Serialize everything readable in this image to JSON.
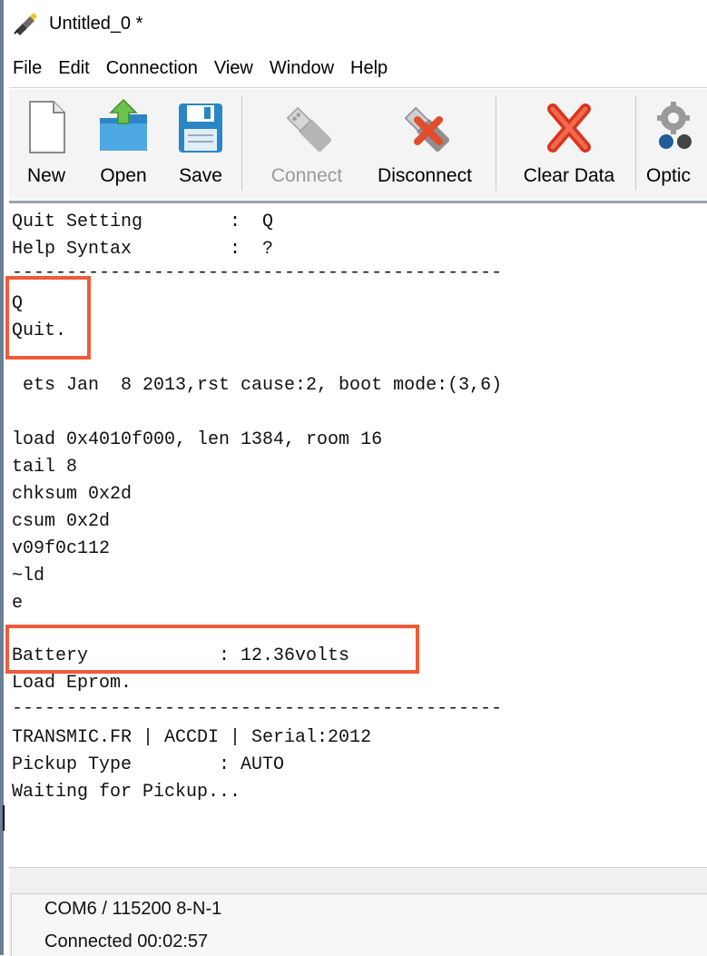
{
  "window": {
    "title": "Untitled_0 *"
  },
  "menu": [
    "File",
    "Edit",
    "Connection",
    "View",
    "Window",
    "Help"
  ],
  "toolbar": {
    "new": "New",
    "open": "Open",
    "save": "Save",
    "connect": "Connect",
    "disconnect": "Disconnect",
    "clear_data": "Clear Data",
    "options": "Optic"
  },
  "terminal": {
    "lines": [
      "Quit Setting        :  Q",
      "Help Syntax         :  ?",
      "---------------------------------------------",
      "Q",
      "Quit.",
      "",
      " ets Jan  8 2013,rst cause:2, boot mode:(3,6)",
      "",
      "load 0x4010f000, len 1384, room 16",
      "tail 8",
      "chksum 0x2d",
      "csum 0x2d",
      "v09f0c112",
      "~ld",
      "e",
      "",
      "Battery            : 12.36volts",
      "Load Eprom.",
      "---------------------------------------------",
      "TRANSMIC.FR | ACCDI | Serial:2012",
      "Pickup Type        : AUTO",
      "Waiting for Pickup..."
    ]
  },
  "status": {
    "port": "COM6 / 115200 8-N-1",
    "connection": "Connected 00:02:57"
  },
  "colors": {
    "highlight": "#ef5b3a",
    "accent": "#3b9bd8"
  }
}
